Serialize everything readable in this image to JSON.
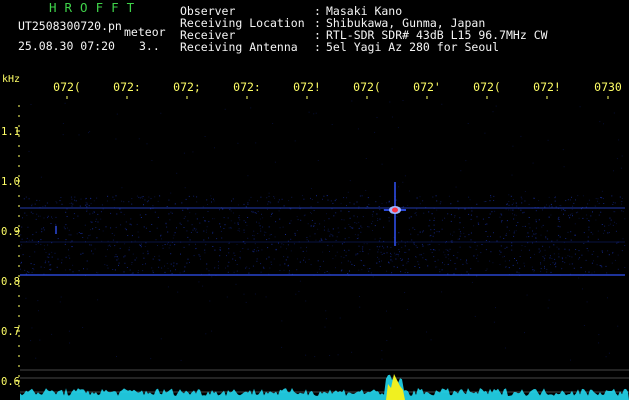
{
  "header": {
    "app_title": "HROFFT",
    "filename": "UT2508300720.pn",
    "meteor_label": "meteor",
    "date_time": "25.08.30 07:20",
    "count": "3..",
    "fields": [
      {
        "label": "Observer",
        "value": "Masaki Kano"
      },
      {
        "label": "Receiving Location",
        "value": "Shibukawa, Gunma, Japan"
      },
      {
        "label": "Receiver",
        "value": "RTL-SDR SDR# 43dB L15 96.7MHz CW"
      },
      {
        "label": "Receiving Antenna",
        "value": "5el Yagi Az 280 for Seoul"
      }
    ],
    "separator": ":"
  },
  "plot": {
    "y_unit": "kHz",
    "y_ticks": [
      "1.1",
      "1.0",
      "0.9",
      "0.8",
      "0.7",
      "0.6"
    ],
    "x_ticks": [
      "072(",
      "072:",
      "072;",
      "072:",
      "072!",
      "072(",
      "072'",
      "072(",
      "072!",
      "0730"
    ],
    "colors": {
      "background": "#000000",
      "axis_text": "#ffff66",
      "grid": "#ffffff",
      "noise": "#1830a8",
      "carrier": "#2a48d8",
      "spectrum": "#22d8f0",
      "meteor_echo": "#ff3344"
    }
  }
}
